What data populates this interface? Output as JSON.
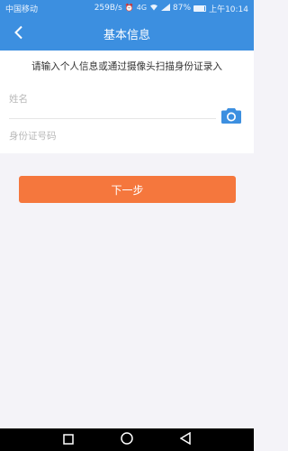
{
  "status_bar": {
    "carrier": "中国移动",
    "speed": "259B/s",
    "network": "4G",
    "battery_percent": "87%",
    "battery_level": 0.87,
    "time": "上午10:14"
  },
  "title_bar": {
    "title": "基本信息",
    "back_icon": "chevron-left-icon"
  },
  "form": {
    "intro": "请输入个人信息或通过摄像头扫描身份证录入",
    "name_placeholder": "姓名",
    "id_placeholder": "身份证号码",
    "camera_icon": "camera-icon"
  },
  "next_button": {
    "label": "下一步"
  },
  "colors": {
    "header": "#3c8fe0",
    "accent": "#f5773d",
    "camera": "#3c8fe0",
    "background": "#f4f3f8"
  },
  "nav": {
    "icons": [
      "square-icon",
      "circle-icon",
      "triangle-back-icon"
    ]
  }
}
